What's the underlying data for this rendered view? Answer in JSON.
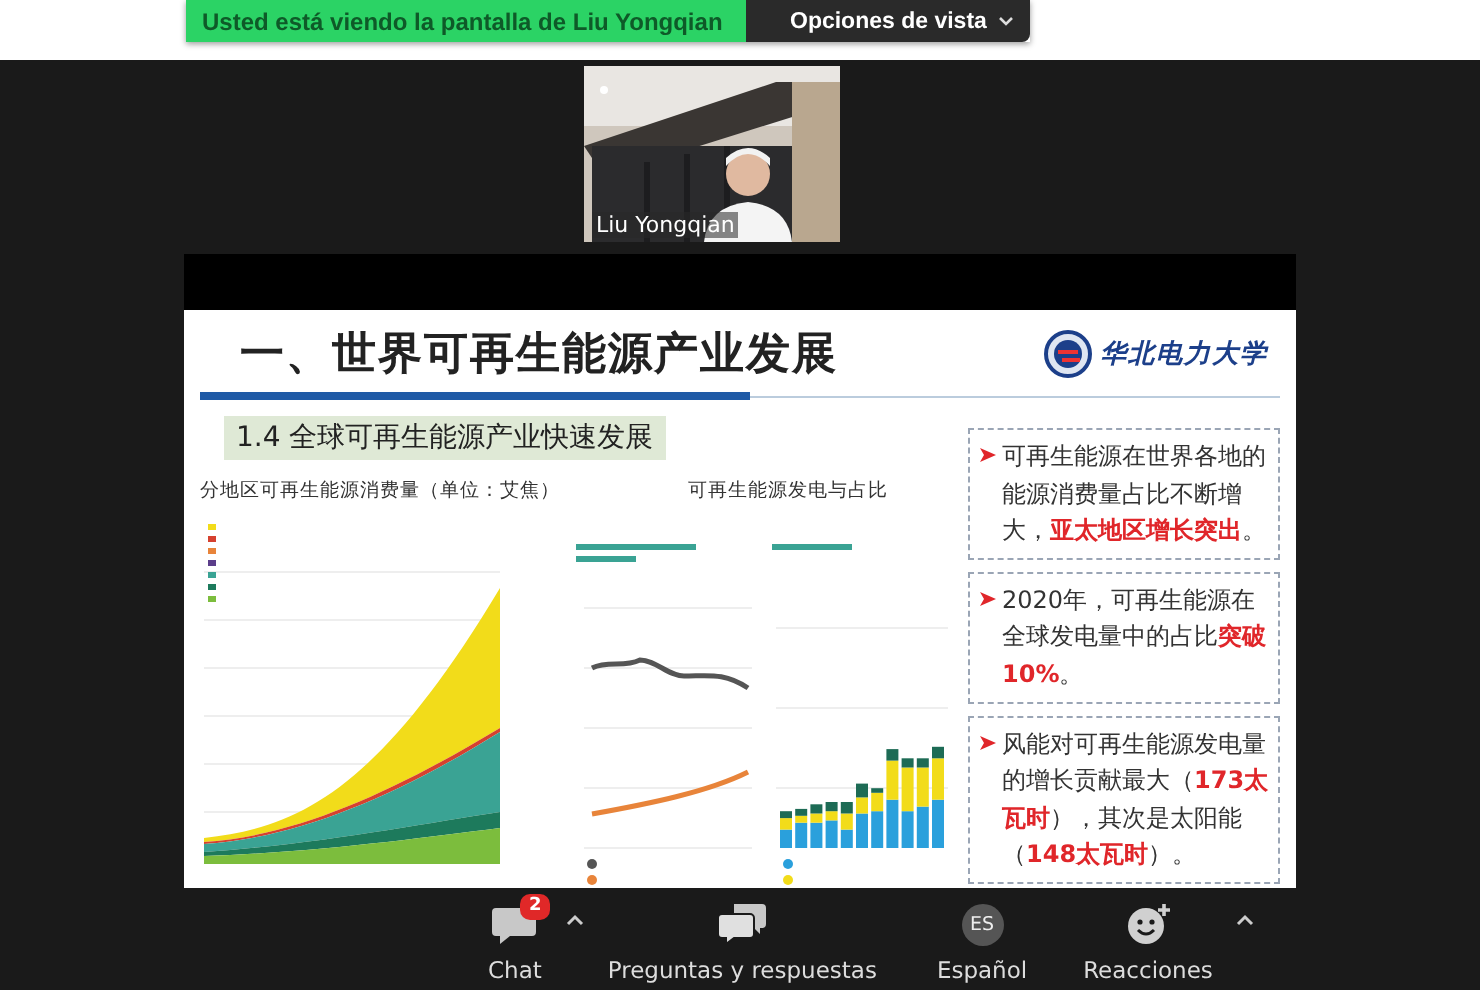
{
  "banner": {
    "text": "Usted está viendo la pantalla de Liu Yongqian",
    "options_button": "Opciones de vista"
  },
  "video": {
    "name": "Liu Yongqian"
  },
  "slide": {
    "title": "一、世界可再生能源产业发展",
    "logo_text": "华北电力大学",
    "subtitle": "1.4 全球可再生能源产业快速发展",
    "charts": [
      {
        "kind": "area",
        "title": "分地区可再生能源消费量（单位：艾焦）"
      },
      {
        "kind": "combo",
        "title": "可再生能源发电与占比"
      }
    ],
    "points": [
      "可再生能源在世界各地的能源消费量占比不断增大，**亚太地区增长突出**。",
      "2020年，可再生能源在全球发电量中的占比**突破10%**。",
      "风能对可再生能源发电量的增长贡献最大（**173太瓦时**），其次是太阳能（**148太瓦时**）。"
    ]
  },
  "toolbar": [
    {
      "kind": "chat",
      "label": "Chat",
      "badge": "2",
      "caret": true
    },
    {
      "kind": "qa",
      "label": "Preguntas y respuestas",
      "caret": false
    },
    {
      "kind": "language",
      "label": "Español",
      "code": "ES",
      "caret": false
    },
    {
      "kind": "reactions",
      "label": "Reacciones",
      "caret": true
    }
  ]
}
